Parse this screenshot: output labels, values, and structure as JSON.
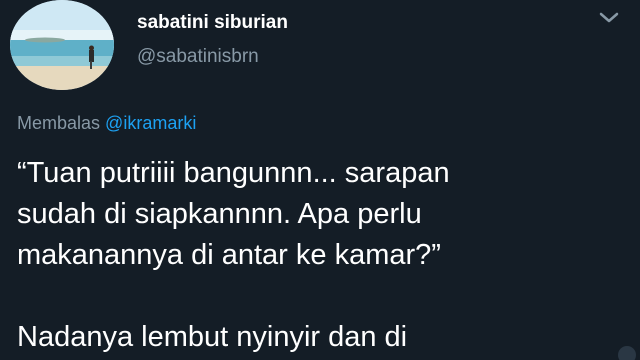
{
  "tweet": {
    "author": {
      "display_name": "sabatini siburian",
      "handle": "@sabatinisbrn",
      "avatar_icon": "beach-photo-avatar"
    },
    "menu_icon": "chevron-down-icon",
    "reply_prefix": "Membalas",
    "reply_to": "@ikramarki",
    "text_lines": [
      "“Tuan putriiii bangunnn... sarapan",
      "sudah di siapkannnn. Apa perlu",
      "makanannya di antar ke kamar?”",
      "Nadanya lembut nyinyir dan di"
    ]
  },
  "colors": {
    "background": "#141d26",
    "text_primary": "#ffffff",
    "text_secondary": "#8899a6",
    "link": "#1da1f2"
  }
}
